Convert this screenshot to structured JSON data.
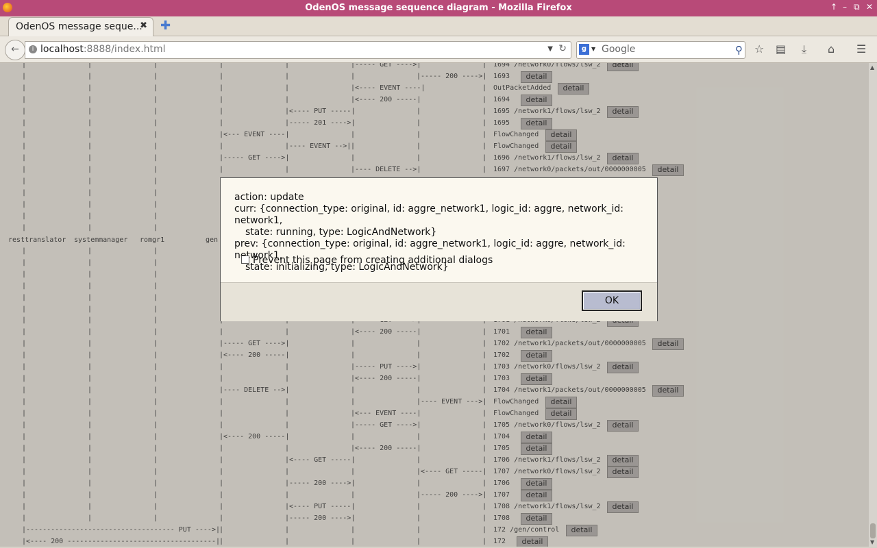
{
  "window": {
    "title": "OdenOS message sequence diagram - Mozilla Firefox"
  },
  "tab": {
    "label": "OdenOS message seque..."
  },
  "navbar": {
    "url_host": "localhost",
    "url_rest": ":8888/index.html",
    "search_placeholder": "Google"
  },
  "lanes": {
    "names": [
      "resttranslator",
      "systemmanager",
      "romgr1",
      "gen"
    ]
  },
  "detail_label": "detail",
  "rows": [
    {
      "arrow": "|----- GET ---->|",
      "info": "1694 /network0/flows/lsw_2",
      "btn": 886
    },
    {
      "arrow": "|----- 200 ---->|",
      "info": "1693",
      "btn": 760
    },
    {
      "arrow": "|<---- EVENT ----|",
      "info": "OutPacketAdded",
      "btn": 814
    },
    {
      "arrow": "|<---- 200 -----|",
      "info": "1694",
      "btn": 760
    },
    {
      "arrow": "|<---- PUT -----|",
      "info": "1695 /network1/flows/lsw_2",
      "btn": 886
    },
    {
      "arrow": "|----- 201 ---->|",
      "info": "1695",
      "btn": 760
    },
    {
      "arrow": "|<--- EVENT ----|",
      "info": "FlowChanged",
      "btn": 796
    },
    {
      "arrow": "|---- EVENT -->|",
      "info": "FlowChanged",
      "btn": 796
    },
    {
      "arrow": "|----- GET ---->|",
      "info": "1696 /network1/flows/lsw_2",
      "btn": 886
    },
    {
      "arrow": "|---- DELETE -->|",
      "info": "1697 /network0/packets/out/0000000005",
      "btn": 952
    },
    {
      "arrow": "|----- GET ---->|",
      "info": "1701 /network0/flows/lsw_2",
      "btn": 886
    },
    {
      "arrow": "|<---- 200 -----|",
      "info": "1701",
      "btn": 760
    },
    {
      "arrow": "|----- GET ---->|",
      "info": "1702 /network1/packets/out/0000000005",
      "btn": 952
    },
    {
      "arrow": "|<---- 200 -----|",
      "info": "1702",
      "btn": 760
    },
    {
      "arrow": "|----- PUT ---->|",
      "info": "1703 /network0/flows/lsw_2",
      "btn": 886
    },
    {
      "arrow": "|<---- 200 -----|",
      "info": "1703",
      "btn": 760
    },
    {
      "arrow": "|---- DELETE -->|",
      "info": "1704 /network1/packets/out/0000000005",
      "btn": 952
    },
    {
      "arrow": "|---- EVENT --->|",
      "info": "FlowChanged",
      "btn": 796
    },
    {
      "arrow": "|<--- EVENT ----|",
      "info": "FlowChanged",
      "btn": 796
    },
    {
      "arrow": "|----- GET ---->|",
      "info": "1705 /network0/flows/lsw_2",
      "btn": 886
    },
    {
      "arrow": "|<---- 200 -----|",
      "info": "1704",
      "btn": 760
    },
    {
      "arrow": "|<---- 200 -----|",
      "info": "1705",
      "btn": 760
    },
    {
      "arrow": "|<---- GET -----|",
      "info": "1706 /network1/flows/lsw_2",
      "btn": 886
    },
    {
      "arrow": "|<---- GET -----|",
      "info": "1707 /network0/flows/lsw_2",
      "btn": 886
    },
    {
      "arrow": "|----- 200 ---->|",
      "info": "1706",
      "btn": 760
    },
    {
      "arrow": "|----- 200 ---->|",
      "info": "1707",
      "btn": 760
    },
    {
      "arrow": "|<---- PUT -----|",
      "info": "1708 /network1/flows/lsw_2",
      "btn": 886
    },
    {
      "arrow": "|----- 200 ---->|",
      "info": "1708",
      "btn": 760
    },
    {
      "arrow": "|------------------------------------ PUT ---->|",
      "info": "172 /gen/control",
      "btn": 826
    },
    {
      "arrow": "|<---- 200 ------------------------------------|",
      "info": "172",
      "btn": 754
    }
  ],
  "dialog": {
    "action_line": "action: update",
    "curr_line1": "curr: {connection_type: original, id: aggre_network1, logic_id: aggre, network_id: network1,",
    "curr_line2": "state: running, type: LogicAndNetwork}",
    "prev_line1": "prev: {connection_type: original, id: aggre_network1, logic_id: aggre, network_id: network1,",
    "prev_line2": "state: initializing, type: LogicAndNetwork}",
    "checkbox_label": "Prevent this page from creating additional dialogs",
    "ok_label": "OK"
  }
}
